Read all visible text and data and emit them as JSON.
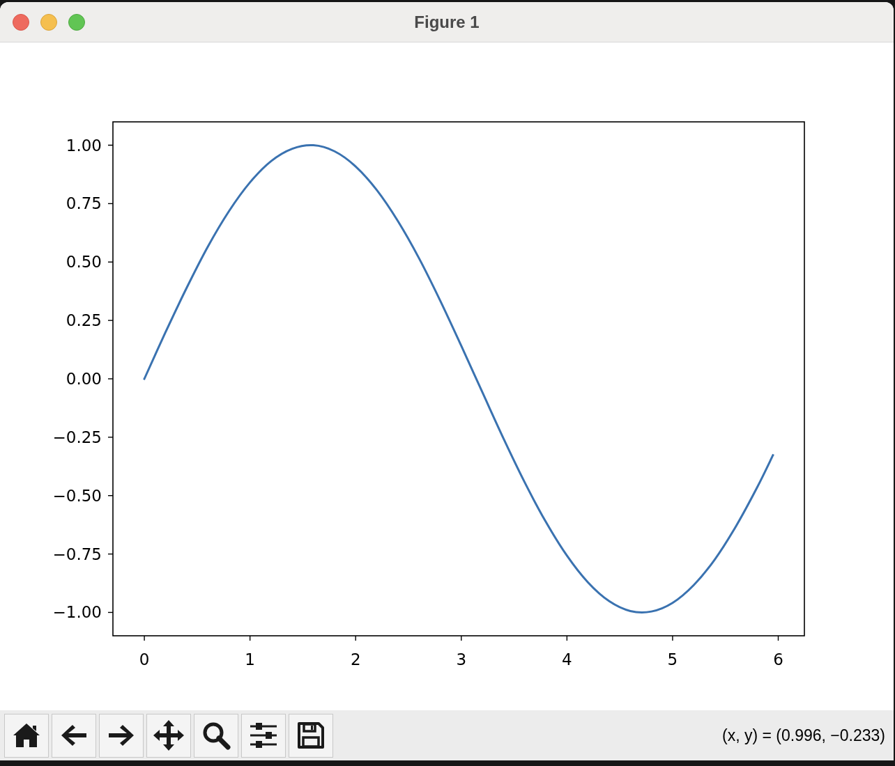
{
  "window": {
    "title": "Figure 1"
  },
  "figure": {
    "chart_data": {
      "type": "line",
      "x": [
        0,
        0.2,
        0.4,
        0.6,
        0.8,
        1.0,
        1.2,
        1.4,
        1.6,
        1.8,
        2.0,
        2.2,
        2.4,
        2.6,
        2.8,
        3.0,
        3.2,
        3.4,
        3.6,
        3.8,
        4.0,
        4.2,
        4.4,
        4.6,
        4.8,
        5.0,
        5.2,
        5.4,
        5.6,
        5.8,
        5.95
      ],
      "series": [
        {
          "color": "#3a72b0",
          "values": [
            0,
            0.199,
            0.389,
            0.565,
            0.717,
            0.841,
            0.932,
            0.985,
            1.0,
            0.974,
            0.909,
            0.808,
            0.675,
            0.516,
            0.335,
            0.141,
            -0.058,
            -0.256,
            -0.443,
            -0.612,
            -0.757,
            -0.872,
            -0.952,
            -0.994,
            -0.996,
            -0.959,
            -0.883,
            -0.773,
            -0.631,
            -0.465,
            -0.327
          ]
        }
      ],
      "xlim": [
        -0.2975,
        6.2475
      ],
      "ylim": [
        -1.1,
        1.1
      ],
      "xticks": [
        0,
        1,
        2,
        3,
        4,
        5,
        6
      ],
      "yticks": [
        {
          "value": 1,
          "label": "1.00"
        },
        {
          "value": 0.75,
          "label": "0.75"
        },
        {
          "value": 0.5,
          "label": "0.50"
        },
        {
          "value": 0.25,
          "label": "0.25"
        },
        {
          "value": 0,
          "label": "0.00"
        },
        {
          "value": -0.25,
          "label": "−0.25"
        },
        {
          "value": -0.5,
          "label": "−0.50"
        },
        {
          "value": -0.75,
          "label": "−0.75"
        },
        {
          "value": -1,
          "label": "−1.00"
        }
      ]
    }
  },
  "status_bar": {
    "coordinates": "(x, y) = (0.996, −0.233)"
  }
}
